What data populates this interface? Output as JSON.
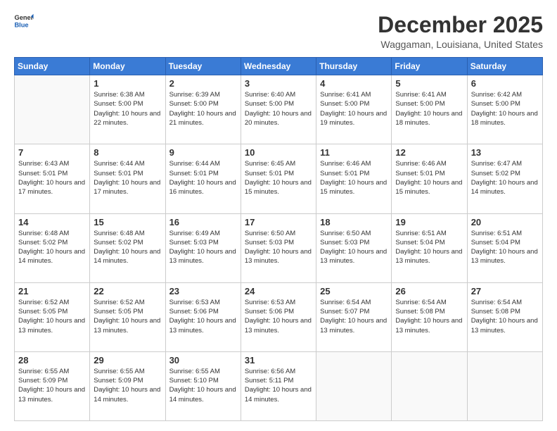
{
  "logo": {
    "line1": "General",
    "line2": "Blue"
  },
  "title": "December 2025",
  "location": "Waggaman, Louisiana, United States",
  "days_of_week": [
    "Sunday",
    "Monday",
    "Tuesday",
    "Wednesday",
    "Thursday",
    "Friday",
    "Saturday"
  ],
  "weeks": [
    [
      {
        "day": "",
        "sunrise": "",
        "sunset": "",
        "daylight": ""
      },
      {
        "day": "1",
        "sunrise": "Sunrise: 6:38 AM",
        "sunset": "Sunset: 5:00 PM",
        "daylight": "Daylight: 10 hours and 22 minutes."
      },
      {
        "day": "2",
        "sunrise": "Sunrise: 6:39 AM",
        "sunset": "Sunset: 5:00 PM",
        "daylight": "Daylight: 10 hours and 21 minutes."
      },
      {
        "day": "3",
        "sunrise": "Sunrise: 6:40 AM",
        "sunset": "Sunset: 5:00 PM",
        "daylight": "Daylight: 10 hours and 20 minutes."
      },
      {
        "day": "4",
        "sunrise": "Sunrise: 6:41 AM",
        "sunset": "Sunset: 5:00 PM",
        "daylight": "Daylight: 10 hours and 19 minutes."
      },
      {
        "day": "5",
        "sunrise": "Sunrise: 6:41 AM",
        "sunset": "Sunset: 5:00 PM",
        "daylight": "Daylight: 10 hours and 18 minutes."
      },
      {
        "day": "6",
        "sunrise": "Sunrise: 6:42 AM",
        "sunset": "Sunset: 5:00 PM",
        "daylight": "Daylight: 10 hours and 18 minutes."
      }
    ],
    [
      {
        "day": "7",
        "sunrise": "Sunrise: 6:43 AM",
        "sunset": "Sunset: 5:01 PM",
        "daylight": "Daylight: 10 hours and 17 minutes."
      },
      {
        "day": "8",
        "sunrise": "Sunrise: 6:44 AM",
        "sunset": "Sunset: 5:01 PM",
        "daylight": "Daylight: 10 hours and 17 minutes."
      },
      {
        "day": "9",
        "sunrise": "Sunrise: 6:44 AM",
        "sunset": "Sunset: 5:01 PM",
        "daylight": "Daylight: 10 hours and 16 minutes."
      },
      {
        "day": "10",
        "sunrise": "Sunrise: 6:45 AM",
        "sunset": "Sunset: 5:01 PM",
        "daylight": "Daylight: 10 hours and 15 minutes."
      },
      {
        "day": "11",
        "sunrise": "Sunrise: 6:46 AM",
        "sunset": "Sunset: 5:01 PM",
        "daylight": "Daylight: 10 hours and 15 minutes."
      },
      {
        "day": "12",
        "sunrise": "Sunrise: 6:46 AM",
        "sunset": "Sunset: 5:01 PM",
        "daylight": "Daylight: 10 hours and 15 minutes."
      },
      {
        "day": "13",
        "sunrise": "Sunrise: 6:47 AM",
        "sunset": "Sunset: 5:02 PM",
        "daylight": "Daylight: 10 hours and 14 minutes."
      }
    ],
    [
      {
        "day": "14",
        "sunrise": "Sunrise: 6:48 AM",
        "sunset": "Sunset: 5:02 PM",
        "daylight": "Daylight: 10 hours and 14 minutes."
      },
      {
        "day": "15",
        "sunrise": "Sunrise: 6:48 AM",
        "sunset": "Sunset: 5:02 PM",
        "daylight": "Daylight: 10 hours and 14 minutes."
      },
      {
        "day": "16",
        "sunrise": "Sunrise: 6:49 AM",
        "sunset": "Sunset: 5:03 PM",
        "daylight": "Daylight: 10 hours and 13 minutes."
      },
      {
        "day": "17",
        "sunrise": "Sunrise: 6:50 AM",
        "sunset": "Sunset: 5:03 PM",
        "daylight": "Daylight: 10 hours and 13 minutes."
      },
      {
        "day": "18",
        "sunrise": "Sunrise: 6:50 AM",
        "sunset": "Sunset: 5:03 PM",
        "daylight": "Daylight: 10 hours and 13 minutes."
      },
      {
        "day": "19",
        "sunrise": "Sunrise: 6:51 AM",
        "sunset": "Sunset: 5:04 PM",
        "daylight": "Daylight: 10 hours and 13 minutes."
      },
      {
        "day": "20",
        "sunrise": "Sunrise: 6:51 AM",
        "sunset": "Sunset: 5:04 PM",
        "daylight": "Daylight: 10 hours and 13 minutes."
      }
    ],
    [
      {
        "day": "21",
        "sunrise": "Sunrise: 6:52 AM",
        "sunset": "Sunset: 5:05 PM",
        "daylight": "Daylight: 10 hours and 13 minutes."
      },
      {
        "day": "22",
        "sunrise": "Sunrise: 6:52 AM",
        "sunset": "Sunset: 5:05 PM",
        "daylight": "Daylight: 10 hours and 13 minutes."
      },
      {
        "day": "23",
        "sunrise": "Sunrise: 6:53 AM",
        "sunset": "Sunset: 5:06 PM",
        "daylight": "Daylight: 10 hours and 13 minutes."
      },
      {
        "day": "24",
        "sunrise": "Sunrise: 6:53 AM",
        "sunset": "Sunset: 5:06 PM",
        "daylight": "Daylight: 10 hours and 13 minutes."
      },
      {
        "day": "25",
        "sunrise": "Sunrise: 6:54 AM",
        "sunset": "Sunset: 5:07 PM",
        "daylight": "Daylight: 10 hours and 13 minutes."
      },
      {
        "day": "26",
        "sunrise": "Sunrise: 6:54 AM",
        "sunset": "Sunset: 5:08 PM",
        "daylight": "Daylight: 10 hours and 13 minutes."
      },
      {
        "day": "27",
        "sunrise": "Sunrise: 6:54 AM",
        "sunset": "Sunset: 5:08 PM",
        "daylight": "Daylight: 10 hours and 13 minutes."
      }
    ],
    [
      {
        "day": "28",
        "sunrise": "Sunrise: 6:55 AM",
        "sunset": "Sunset: 5:09 PM",
        "daylight": "Daylight: 10 hours and 13 minutes."
      },
      {
        "day": "29",
        "sunrise": "Sunrise: 6:55 AM",
        "sunset": "Sunset: 5:09 PM",
        "daylight": "Daylight: 10 hours and 14 minutes."
      },
      {
        "day": "30",
        "sunrise": "Sunrise: 6:55 AM",
        "sunset": "Sunset: 5:10 PM",
        "daylight": "Daylight: 10 hours and 14 minutes."
      },
      {
        "day": "31",
        "sunrise": "Sunrise: 6:56 AM",
        "sunset": "Sunset: 5:11 PM",
        "daylight": "Daylight: 10 hours and 14 minutes."
      },
      {
        "day": "",
        "sunrise": "",
        "sunset": "",
        "daylight": ""
      },
      {
        "day": "",
        "sunrise": "",
        "sunset": "",
        "daylight": ""
      },
      {
        "day": "",
        "sunrise": "",
        "sunset": "",
        "daylight": ""
      }
    ]
  ]
}
